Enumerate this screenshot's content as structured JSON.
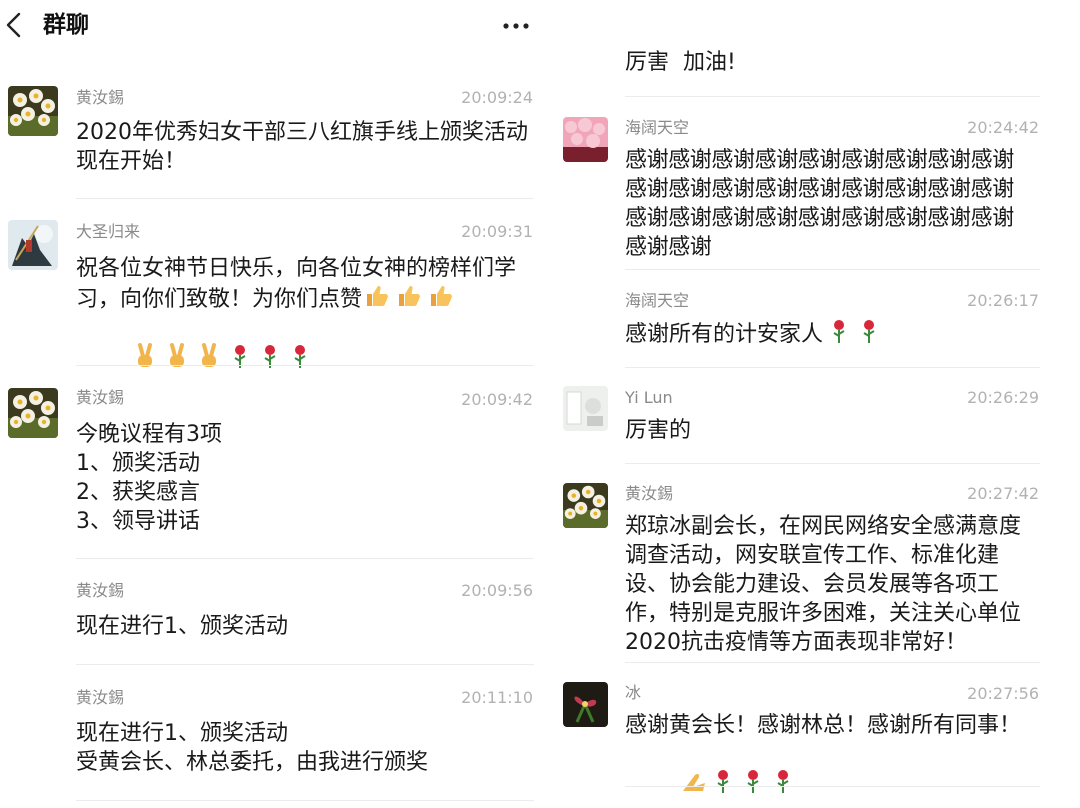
{
  "header": {
    "title": "群聊"
  },
  "left_messages": [
    {
      "sender": "黄汝錫",
      "time": "20:09:24",
      "text": "2020年优秀妇女干部三八红旗手线上颁奖活动现在开始！"
    },
    {
      "sender": "大圣归来",
      "time": "20:09:31",
      "text": "祝各位女神节日快乐，向各位女神的榜样们学习，向你们致敬！为你们点赞",
      "emoji_line": [
        "victory-hand",
        "victory-hand",
        "victory-hand",
        "rose",
        "rose",
        "rose"
      ],
      "inline_emoji": [
        "thumbs-up",
        "thumbs-up",
        "thumbs-up"
      ]
    },
    {
      "sender": "黄汝錫",
      "time": "20:09:42",
      "text": "今晚议程有3项\n1、颁奖活动\n2、获奖感言\n3、领导讲话"
    },
    {
      "sender": "黄汝錫",
      "time": "20:09:56",
      "text": "现在进行1、颁奖活动"
    },
    {
      "sender": "黄汝錫",
      "time": "20:11:10",
      "text": "现在进行1、颁奖活动\n受黄会长、林总委托，由我进行颁奖"
    }
  ],
  "right_messages": [
    {
      "sender": "",
      "time": "",
      "text": "厉害  加油!"
    },
    {
      "sender": "海阔天空",
      "time": "20:24:42",
      "text": "感谢感谢感谢感谢感谢感谢感谢感谢感谢感谢感谢感谢感谢感谢感谢感谢感谢感谢感谢感谢感谢感谢感谢感谢感谢感谢感谢感谢感谢"
    },
    {
      "sender": "海阔天空",
      "time": "20:26:17",
      "text": "感谢所有的计安家人",
      "inline_emoji": [
        "rose",
        "rose"
      ]
    },
    {
      "sender": "Yi Lun",
      "time": "20:26:29",
      "text": "厉害的"
    },
    {
      "sender": "黄汝錫",
      "time": "20:27:42",
      "text": "郑琼冰副会长，在网民网络安全感满意度调查活动，网安联宣传工作、标准化建设、协会能力建设、会员发展等各项工作，特别是克服许多困难，关注关心单位2020抗击疫情等方面表现非常好！"
    },
    {
      "sender": "冰",
      "time": "20:27:56",
      "text": "感谢黄会长！感谢林总！感谢所有同事！",
      "emoji_line": [
        "folded-hands",
        "rose",
        "rose",
        "rose"
      ]
    }
  ],
  "colors": {
    "sender": "#8a8a8a",
    "time": "#b2b2b2",
    "text": "#1a1a1a",
    "separator": "#ececec"
  }
}
